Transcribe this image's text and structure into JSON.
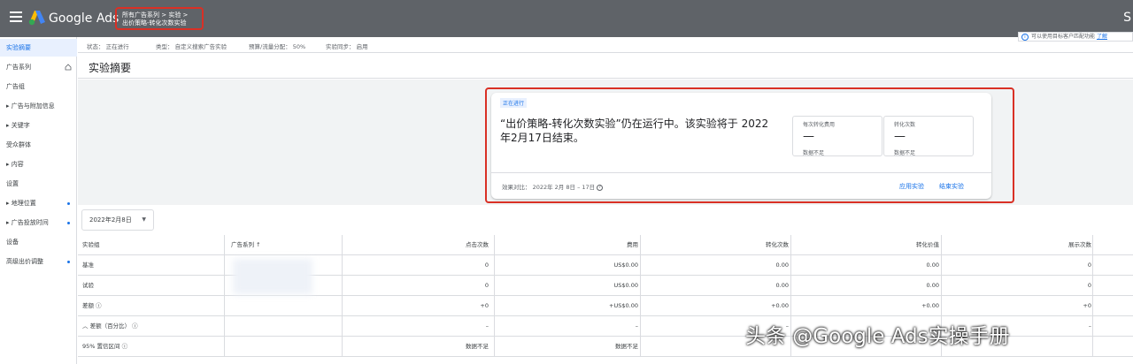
{
  "header": {
    "brand": "Google Ads",
    "breadcrumb_path": "所有广告系列 > 实验 >",
    "breadcrumb_current": "出价策略-转化次数实验",
    "avatar_char": "S"
  },
  "sidebar": {
    "items": [
      {
        "label": "实验摘要",
        "active": true,
        "dot": false
      },
      {
        "label": "广告系列",
        "dot": false
      },
      {
        "label": "广告组",
        "dot": false
      },
      {
        "label": "▸ 广告与附加信息",
        "dot": false
      },
      {
        "label": "▸ 关键字",
        "dot": false
      },
      {
        "label": "受众群体",
        "dot": false
      },
      {
        "label": "▸ 内容",
        "dot": false
      },
      {
        "label": "设置",
        "dot": false
      },
      {
        "label": "▸ 地理位置",
        "dot": true
      },
      {
        "label": "▸ 广告投放时间",
        "dot": true
      },
      {
        "label": "设备",
        "dot": false
      },
      {
        "label": "高级出价调整",
        "dot": true
      }
    ]
  },
  "status_bar": {
    "status": "状态： 正在进行",
    "type": "类型： 自定义搜索广告实验",
    "split": "预算/流量分配： 50%",
    "sync": "实验同步： 启用"
  },
  "notice": {
    "text": "可以使用目标客户匹配功能",
    "link": "了解"
  },
  "page_title": "实验摘要",
  "summary": {
    "chip": "正在进行",
    "message": "“出价策略-转化次数实验”仍在运行中。该实验将于 2022年2月17日结束。",
    "metrics": [
      {
        "label": "每次转化费用",
        "value": "—",
        "note": "数据不足"
      },
      {
        "label": "转化次数",
        "value": "—",
        "note": "数据不足"
      }
    ],
    "date_range": "效果对比： 2022年 2月 8日 – 17日",
    "apply": "应用实验",
    "end": "结束实验"
  },
  "date_selector": "2022年2月8日",
  "table": {
    "headers": [
      "实验组",
      "广告系列 ↑",
      "点击次数",
      "费用",
      "转化次数",
      "转化价值",
      "展示次数"
    ],
    "rows": [
      {
        "c": [
          "基准",
          "",
          "0",
          "US$0.00",
          "0.00",
          "0.00",
          "0"
        ]
      },
      {
        "c": [
          "试验",
          "",
          "0",
          "US$0.00",
          "0.00",
          "0.00",
          "0"
        ]
      },
      {
        "c": [
          "差额 ⓘ",
          "",
          "+0",
          "+US$0.00",
          "+0.00",
          "+0.00",
          "+0"
        ]
      },
      {
        "c": [
          "︿ 差额（百分比） ⓘ",
          "",
          "–",
          "–",
          "–",
          "–",
          "–"
        ]
      },
      {
        "c": [
          "95% 置信区间 ⓘ",
          "",
          "数据不足",
          "数据不足",
          "",
          "",
          ""
        ]
      }
    ]
  },
  "watermark": "头条 @Google Ads实操手册"
}
